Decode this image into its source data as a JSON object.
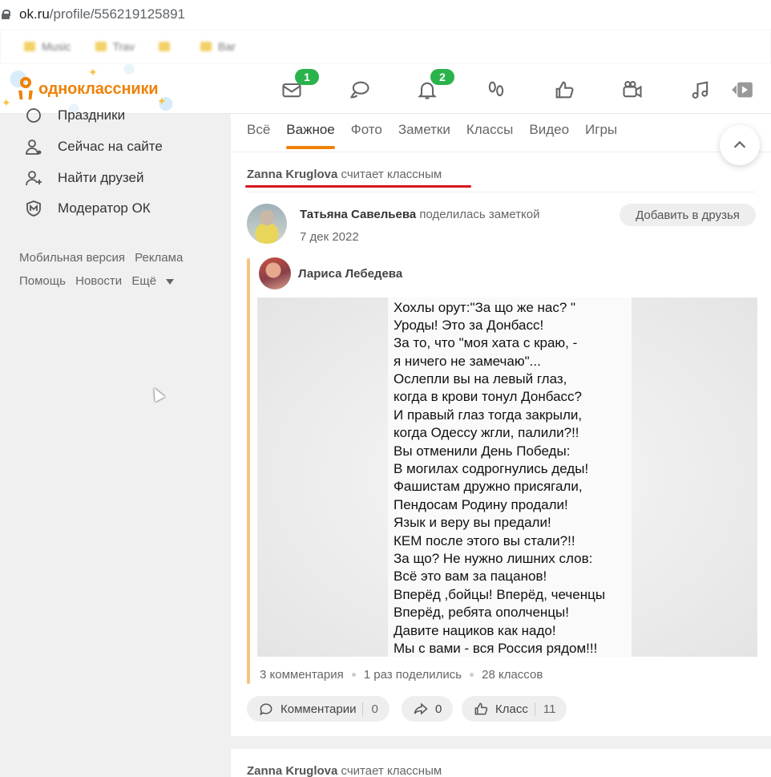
{
  "browser": {
    "url_host": "ok.ru",
    "url_path": "/profile/556219125891",
    "bookmarks": [
      "Music",
      "Trav",
      "",
      "Bar",
      ""
    ]
  },
  "header": {
    "logo_text": "одноклассники",
    "brand_color": "#ee8208",
    "icons": [
      {
        "name": "messages-icon",
        "badge": "1"
      },
      {
        "name": "discussions-icon",
        "badge": ""
      },
      {
        "name": "notifications-icon",
        "badge": "2"
      },
      {
        "name": "guests-icon",
        "badge": ""
      },
      {
        "name": "likes-icon",
        "badge": ""
      },
      {
        "name": "video-icon",
        "badge": ""
      },
      {
        "name": "music-icon",
        "badge": ""
      },
      {
        "name": "play-icon",
        "badge": ""
      }
    ],
    "badge_color": "#2bb34b"
  },
  "sidebar": {
    "items": [
      {
        "label": "Праздники",
        "icon": "gift-icon"
      },
      {
        "label": "Сейчас на сайте",
        "icon": "user-online-icon"
      },
      {
        "label": "Найти друзей",
        "icon": "add-friend-icon"
      },
      {
        "label": "Модератор ОК",
        "icon": "shield-icon"
      }
    ],
    "links_row1": [
      "Мобильная версия",
      "Реклама"
    ],
    "links_row2": [
      "Помощь",
      "Новости",
      "Ещё"
    ]
  },
  "feed": {
    "tabs": [
      "Всё",
      "Важное",
      "Фото",
      "Заметки",
      "Классы",
      "Видео",
      "Игры"
    ],
    "active_tab": "Важное",
    "liked_by_name": "Zanna Kruglova",
    "liked_by_text": "считает классным",
    "post": {
      "author": "Татьяна Савельева",
      "action": "поделилась заметкой",
      "date": "7 дек 2022",
      "add_friend_label": "Добавить в друзья",
      "repost_author": "Лариса Лебедева",
      "poem": [
        "Хохлы орут:\"За що же нас? \"",
        "Уроды! Это за Донбасс!",
        "За то, что \"моя хата с краю, -",
        "я ничего не замечаю\"...",
        "Ослепли вы на левый глаз,",
        "когда в крови тонул Донбасс?",
        "И правый глаз тогда закрыли,",
        "когда Одессу жгли, палили?!!",
        "Вы отменили День Победы:",
        "В могилах содрогнулись деды!",
        "Фашистам дружно присягали,",
        "Пендосам Родину продали!",
        "Язык и веру вы предали!",
        "КЕМ после этого вы стали?!!",
        "За що? Не нужно лишних слов:",
        "Всё это вам за пацанов!",
        "Вперёд ,бойцы! Вперёд, чеченцы",
        "Вперёд, ребята ополченцы!",
        "Давите нациков как надо!",
        "Мы с вами - вся Россия рядом!!!"
      ],
      "stats": [
        "3 комментария",
        "1 раз поделились",
        "28 классов"
      ],
      "actions": {
        "comments_label": "Комментарии",
        "comments_count": "0",
        "share_count": "0",
        "class_label": "Класс",
        "class_count": "11"
      }
    },
    "next_liked_by_name": "Zanna Kruglova",
    "next_liked_by_text": "считает классным"
  }
}
